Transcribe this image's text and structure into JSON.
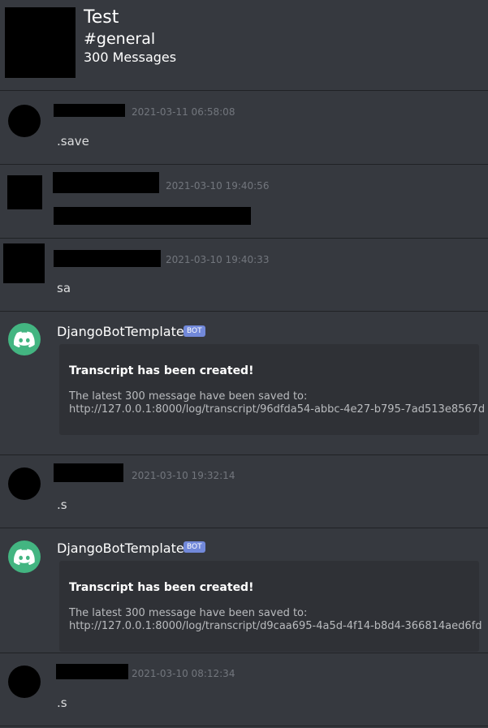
{
  "header": {
    "guild_name": "Test",
    "channel": "#general",
    "message_count": "300 Messages"
  },
  "messages": [
    {
      "timestamp": "2021-03-11 06:58:08",
      "content": ".save"
    },
    {
      "timestamp": "2021-03-10 19:40:56",
      "content": ""
    },
    {
      "timestamp": "2021-03-10 19:40:33",
      "content": "sa"
    },
    {
      "author": "DjangoBotTemplate",
      "tag": "BOT",
      "embed": {
        "title": "Transcript has been created!",
        "line1": "The latest 300 message have been saved to:",
        "line2": "http://127.0.0.1:8000/log/transcript/96dfda54-abbc-4e27-b795-7ad513e8567d"
      }
    },
    {
      "timestamp": "2021-03-10 19:32:14",
      "content": ".s"
    },
    {
      "author": "DjangoBotTemplate",
      "tag": "BOT",
      "embed": {
        "title": "Transcript has been created!",
        "line1": "The latest 300 message have been saved to:",
        "line2": "http://127.0.0.1:8000/log/transcript/d9caa695-4a5d-4f14-b8d4-366814aed6fd"
      }
    },
    {
      "timestamp": "2021-03-10 08:12:34",
      "content": ".s"
    }
  ],
  "colors": {
    "background": "#36393f",
    "embed_background": "#2f3136",
    "bot_avatar": "#43b581",
    "bot_tag": "#7289da",
    "timestamp": "#72767d"
  },
  "icons": {
    "bot_avatar": "discord-logo-icon"
  }
}
